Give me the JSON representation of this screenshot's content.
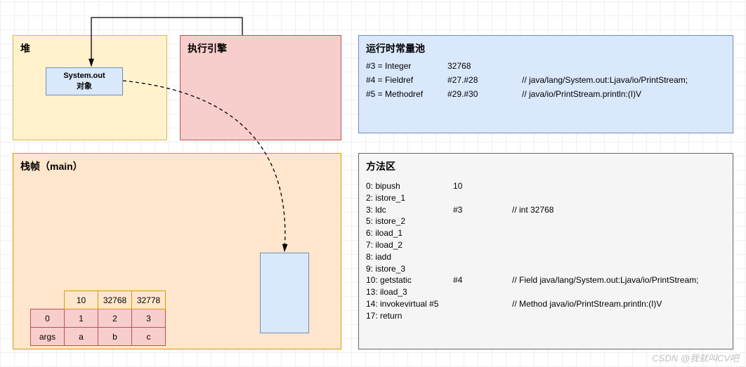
{
  "heap": {
    "title": "堆",
    "obj_line1": "System.out",
    "obj_line2": "对象"
  },
  "engine": {
    "title": "执行引擎"
  },
  "constpool": {
    "title": "运行时常量池",
    "rows": [
      {
        "id": "#3 = Integer",
        "ref": "32768",
        "comment": ""
      },
      {
        "id": "#4 = Fieldref",
        "ref": "#27.#28",
        "comment": "// java/lang/System.out:Ljava/io/PrintStream;"
      },
      {
        "id": "#5 = Methodref",
        "ref": "#29.#30",
        "comment": "// java/io/PrintStream.println:(I)V"
      }
    ]
  },
  "frame": {
    "title": "栈帧（main）",
    "vars": {
      "labels": [
        "0",
        "1",
        "2",
        "3"
      ],
      "names": [
        "args",
        "a",
        "b",
        "c"
      ],
      "values": [
        "",
        "10",
        "32768",
        "32778"
      ]
    }
  },
  "methodarea": {
    "title": "方法区",
    "instructions": [
      {
        "a": "0: bipush",
        "b": "10",
        "c": ""
      },
      {
        "a": "2: istore_1",
        "b": "",
        "c": ""
      },
      {
        "a": "3: ldc",
        "b": "#3",
        "c": "// int 32768"
      },
      {
        "a": "5: istore_2",
        "b": "",
        "c": ""
      },
      {
        "a": "6: iload_1",
        "b": "",
        "c": ""
      },
      {
        "a": "7: iload_2",
        "b": "",
        "c": ""
      },
      {
        "a": "8: iadd",
        "b": "",
        "c": ""
      },
      {
        "a": "9: istore_3",
        "b": "",
        "c": ""
      },
      {
        "a": "10: getstatic",
        "b": "#4",
        "c": "// Field java/lang/System.out:Ljava/io/PrintStream;"
      },
      {
        "a": "13: iload_3",
        "b": "",
        "c": ""
      },
      {
        "a": "14: invokevirtual #5",
        "b": "",
        "c": "// Method java/io/PrintStream.println:(I)V"
      },
      {
        "a": "17: return",
        "b": "",
        "c": ""
      }
    ]
  },
  "watermark": "CSDN @我就叫CV吧"
}
